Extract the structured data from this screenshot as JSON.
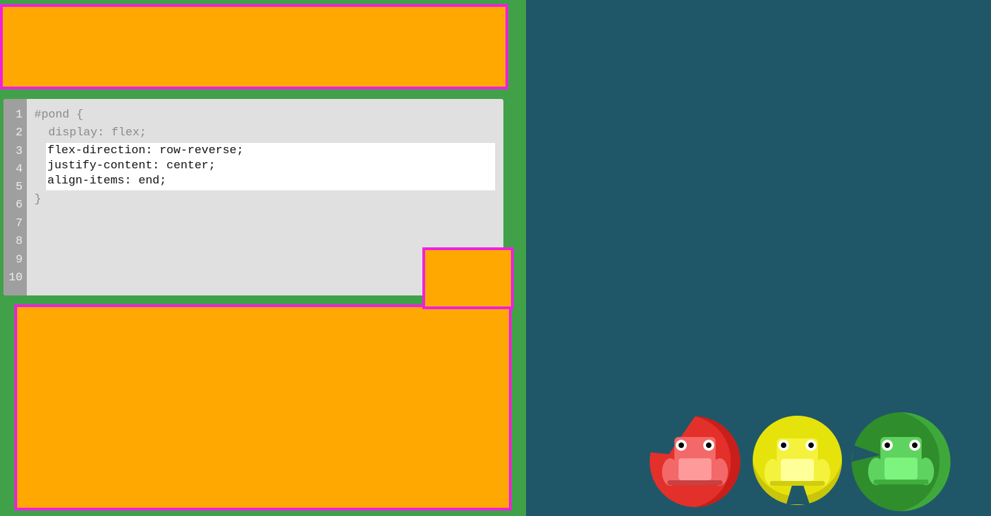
{
  "editor": {
    "line_numbers": [
      "1",
      "2",
      "3",
      "4",
      "5",
      "6",
      "7",
      "8",
      "9",
      "10"
    ],
    "static_lines": {
      "selector_open": "#pond {",
      "display_rule": "  display: flex;",
      "close": "}"
    },
    "input_lines": [
      "flex-direction: row-reverse;",
      "justify-content: center;",
      "align-items: end;"
    ]
  },
  "colors": {
    "sidebar_bg": "#41a148",
    "pond_bg": "#1f5768",
    "highlight_fill": "#ffa801",
    "highlight_border": "#f01fe0",
    "editor_bg": "#e0e0e0",
    "gutter_bg": "#9f9f9f"
  },
  "frogs": [
    {
      "name": "red-frog-icon",
      "color": "red"
    },
    {
      "name": "yellow-frog-icon",
      "color": "yellow"
    },
    {
      "name": "green-frog-icon",
      "color": "green"
    }
  ]
}
